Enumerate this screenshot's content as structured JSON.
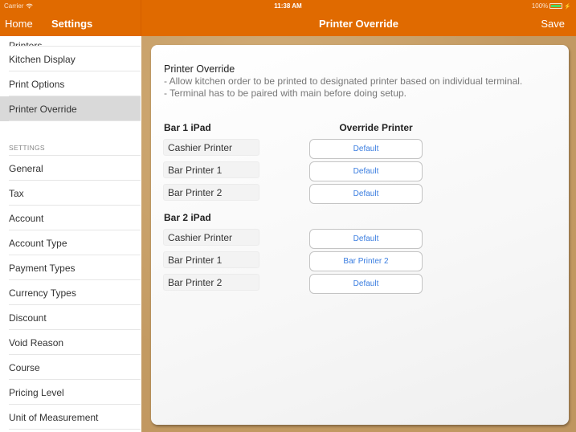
{
  "status_bar": {
    "carrier": "Carrier",
    "time": "11:38 AM",
    "battery": "100%",
    "battery_level": 1.0
  },
  "nav": {
    "home_label": "Home",
    "settings_title": "Settings",
    "page_title": "Printer Override",
    "save_label": "Save"
  },
  "sidebar": {
    "top_items": [
      {
        "label": "Printers"
      },
      {
        "label": "Kitchen Display"
      },
      {
        "label": "Print Options"
      },
      {
        "label": "Printer Override",
        "selected": true
      }
    ],
    "section_header": "SETTINGS",
    "settings_items": [
      {
        "label": "General"
      },
      {
        "label": "Tax"
      },
      {
        "label": "Account"
      },
      {
        "label": "Account Type"
      },
      {
        "label": "Payment Types"
      },
      {
        "label": "Currency Types"
      },
      {
        "label": "Discount"
      },
      {
        "label": "Void Reason"
      },
      {
        "label": "Course"
      },
      {
        "label": "Pricing Level"
      },
      {
        "label": "Unit of Measurement"
      }
    ]
  },
  "main": {
    "title": "Printer Override",
    "description_line1": " - Allow kitchen order to be printed to designated printer based on individual terminal.",
    "description_line2": " - Terminal has to be paired with main before doing setup.",
    "override_column_header": "Override Printer",
    "devices": [
      {
        "name": "Bar 1 iPad",
        "printers": [
          {
            "printer": "Cashier Printer",
            "override": "Default"
          },
          {
            "printer": "Bar Printer 1",
            "override": "Default"
          },
          {
            "printer": "Bar Printer 2",
            "override": "Default"
          }
        ]
      },
      {
        "name": "Bar 2 iPad",
        "printers": [
          {
            "printer": "Cashier Printer",
            "override": "Default"
          },
          {
            "printer": "Bar Printer 1",
            "override": "Bar Printer 2"
          },
          {
            "printer": "Bar Printer 2",
            "override": "Default"
          }
        ]
      }
    ]
  }
}
